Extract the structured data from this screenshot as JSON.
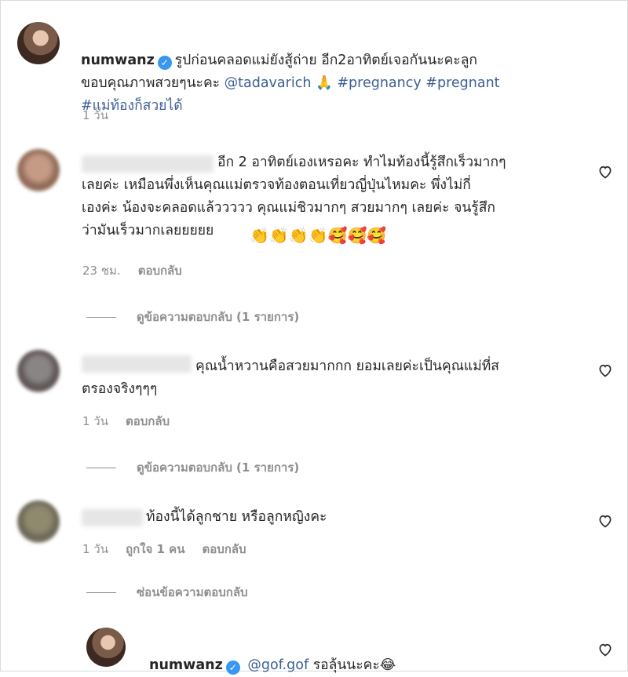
{
  "post": {
    "username": "numwanz",
    "caption_part1": "รูปก่อนคลอดแม่ยังสู้ถ่าย อีก2อาทิตย์เจอกันนะคะลูก",
    "caption_part2": "ขอบคุณภาพสวยๆนะคะ",
    "mention": "@tadavarich",
    "pray_emoji": "🙏",
    "hashtag1": "#pregnancy",
    "hashtag2": "#pregnant",
    "hashtag3": "#แม่ท้องก็สวยได้",
    "time": "1 วัน"
  },
  "comments": [
    {
      "text": "อีก 2 อาทิตย์เองเหรอคะ ทำไมท้องนี้รู้สึกเร็วมากๆ\nเลยค่ะ เหมือนพึ่งเห็นคุณแม่ตรวจท้องตอนเที่ยวญี่ปุ่นไหมคะ พึ่งไม่กี่\nเองค่ะ น้องจะคลอดแล้ววววว คุณแม่ชิวมากๆ สวยมากๆ เลยค่ะ จนรู้สึก\nว่ามันเร็วมากเลยยยยย",
      "emojis": "👏👏👏👏🥰🥰🥰",
      "time": "23 ชม.",
      "reply": "ตอบกลับ",
      "view_replies": "ดูข้อความตอบกลับ (1 รายการ)"
    },
    {
      "text": "คุณน้ำหวานคือสวยมากกก ยอมเลยค่ะเป็นคุณแม่ที่ส\nตรองจริงๆๆๆ",
      "time": "1 วัน",
      "reply": "ตอบกลับ",
      "view_replies": "ดูข้อความตอบกลับ (1 รายการ)"
    },
    {
      "text": "ท้องนี้ได้ลูกชาย หรือลูกหญิงคะ",
      "time": "1 วัน",
      "likes": "ถูกใจ 1 คน",
      "reply": "ตอบกลับ",
      "hide_replies": "ซ่อนข้อความตอบกลับ"
    }
  ],
  "reply": {
    "username": "numwanz",
    "mention": "@gof.gof",
    "text": "รอลุ้นนะคะ",
    "emoji": "😂"
  },
  "icons": {
    "heart": "heart-icon",
    "verified": "verified-badge-icon"
  },
  "colors": {
    "link": "#3d5f95",
    "verified": "#3897f0",
    "meta": "#8e8e8e"
  }
}
